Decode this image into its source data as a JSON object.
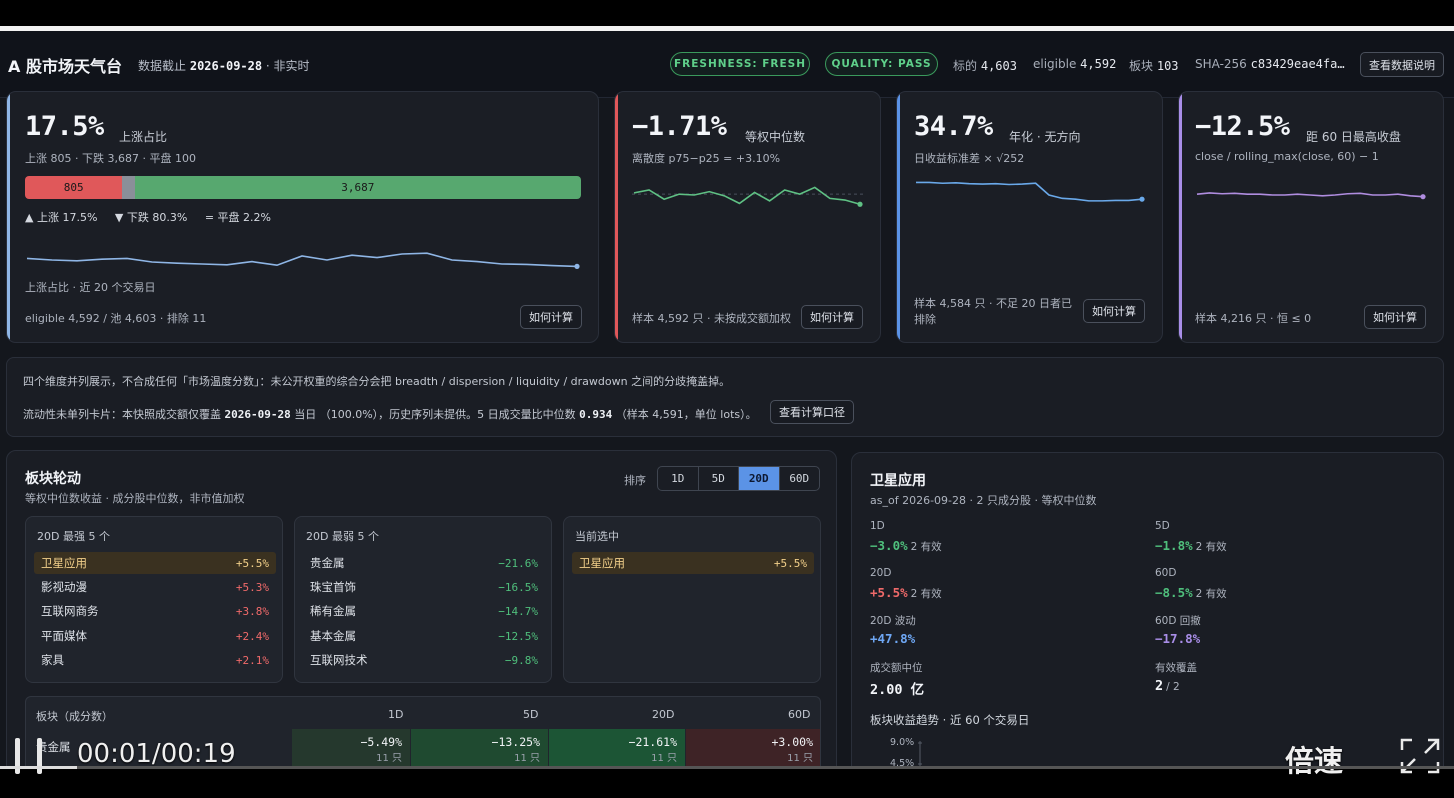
{
  "header": {
    "title": "A 股市场天气台",
    "date_label": "数据截止",
    "date": "2026-09-28",
    "date_suffix": "· 非实时",
    "freshness": "FRESHNESS: FRESH",
    "quality": "QUALITY: PASS",
    "stat1_label": "标的",
    "stat1_value": "4,603",
    "stat2_label": "eligible",
    "stat2_value": "4,592",
    "stat3_label": "板块",
    "stat3_value": "103",
    "hash_label": "SHA-256",
    "hash_value": "c83429eae4fa…",
    "data_button": "查看数据说明"
  },
  "cards": {
    "breadth": {
      "value": "17.5%",
      "unit": "上涨占比",
      "sub": "上涨 805 · 下跌 3,687 · 平盘 100",
      "up_count": 805,
      "down_count": 3687,
      "flat_count": 100,
      "up_label": "805",
      "down_label": "3,687",
      "legend_up": "▲ 上涨 17.5%",
      "legend_down": "▼ 下跌 80.3%",
      "legend_flat": "= 平盘 2.2%",
      "spark_label": "上涨占比 · 近 20 个交易日",
      "footer": "eligible 4,592 / 池 4,603 · 排除 11",
      "button": "如何计算",
      "spark": [
        0.44,
        0.4,
        0.38,
        0.42,
        0.44,
        0.35,
        0.32,
        0.3,
        0.28,
        0.36,
        0.27,
        0.5,
        0.4,
        0.52,
        0.46,
        0.55,
        0.57,
        0.4,
        0.36,
        0.3,
        0.29,
        0.26,
        0.24
      ]
    },
    "dispersion": {
      "value": "−1.71%",
      "unit": "等权中位数",
      "sub": "离散度 p75−p25 = +3.10%",
      "footer": "样本 4,592 只 · 未按成交额加权",
      "button": "如何计算",
      "spark": [
        0.55,
        0.62,
        0.4,
        0.52,
        0.5,
        0.58,
        0.48,
        0.3,
        0.56,
        0.36,
        0.62,
        0.52,
        0.68,
        0.42,
        0.38,
        0.28
      ]
    },
    "volatility": {
      "value": "34.7%",
      "unit": "年化 · 无方向",
      "sub": "日收益标准差 × √252",
      "footer_line1": "样本 4,584 只 · 不足 20 日者已",
      "footer_line2": "排除",
      "button": "如何计算",
      "spark": [
        0.8,
        0.8,
        0.78,
        0.79,
        0.77,
        0.76,
        0.77,
        0.75,
        0.76,
        0.78,
        0.5,
        0.42,
        0.4,
        0.36,
        0.36,
        0.37,
        0.37,
        0.4
      ]
    },
    "drawdown": {
      "value": "−12.5%",
      "unit": "距 60 日最高收盘",
      "sub": "close / rolling_max(close, 60) − 1",
      "footer": "样本 4,216 只 · 恒 ≤ 0",
      "button": "如何计算",
      "spark": [
        0.52,
        0.55,
        0.53,
        0.54,
        0.52,
        0.52,
        0.5,
        0.5,
        0.52,
        0.5,
        0.48,
        0.5,
        0.53,
        0.54,
        0.5,
        0.5,
        0.52,
        0.48,
        0.46
      ]
    }
  },
  "notes": {
    "line1": "四个维度并列展示，不合成任何「市场温度分数」：未公开权重的综合分会把 breadth / dispersion / liquidity / drawdown 之间的分歧掩盖掉。",
    "line2_a": "流动性未单列卡片：本快照成交额仅覆盖",
    "line2_date": "2026-09-28",
    "line2_b": "当日 （100.0%），历史序列未提供。5 日成交量比中位数",
    "line2_ratio": "0.934",
    "line2_c": "（样本 4,591，单位 lots）。",
    "button": "查看计算口径"
  },
  "sector": {
    "title": "板块轮动",
    "subtitle": "等权中位数收益 · 成分股中位数，非市值加权",
    "sort_label": "排序",
    "tabs": [
      "1D",
      "5D",
      "20D",
      "60D"
    ],
    "active_tab": "20D",
    "strong_title": "20D 最强 5 个",
    "strong": [
      {
        "name": "卫星应用",
        "value": "+5.5%"
      },
      {
        "name": "影视动漫",
        "value": "+5.3%"
      },
      {
        "name": "互联网商务",
        "value": "+3.8%"
      },
      {
        "name": "平面媒体",
        "value": "+2.4%"
      },
      {
        "name": "家具",
        "value": "+2.1%"
      }
    ],
    "weak_title": "20D 最弱 5 个",
    "weak": [
      {
        "name": "贵金属",
        "value": "−21.6%"
      },
      {
        "name": "珠宝首饰",
        "value": "−16.5%"
      },
      {
        "name": "稀有金属",
        "value": "−14.7%"
      },
      {
        "name": "基本金属",
        "value": "−12.5%"
      },
      {
        "name": "互联网技术",
        "value": "−9.8%"
      }
    ],
    "current_title": "当前选中",
    "current": {
      "name": "卫星应用",
      "value": "+5.5%"
    },
    "table": {
      "headers": [
        "板块（成分数）",
        "1D",
        "5D",
        "20D",
        "60D"
      ],
      "row": {
        "name": "贵金属",
        "c1": "−5.49%",
        "c2": "−13.25%",
        "c3": "−21.61%",
        "c4": "+3.00%",
        "n1": "11 只",
        "n2": "11 只",
        "n3": "11 只",
        "n4": "11 只"
      }
    }
  },
  "detail": {
    "title": "卫星应用",
    "subtitle": "as_of 2026-09-28 · 2 只成分股 · 等权中位数",
    "m1_label": "1D",
    "m1_value": "−3.0%",
    "m1_note": "2 有效",
    "m2_label": "5D",
    "m2_value": "−1.8%",
    "m2_note": "2 有效",
    "m3_label": "20D",
    "m3_value": "+5.5%",
    "m3_note": "2 有效",
    "m4_label": "60D",
    "m4_value": "−8.5%",
    "m4_note": "2 有效",
    "m5_label": "20D 波动",
    "m5_value": "+47.8%",
    "m6_label": "60D 回撤",
    "m6_value": "−17.8%",
    "m7_label": "成交额中位",
    "m7_value": "2.00 亿",
    "m8_label": "有效覆盖",
    "m8_value": "2",
    "m8_total": "/ 2",
    "trend_title": "板块收益趋势 · 近 60 个交易日",
    "trend_ticks": [
      "9.0%",
      "4.5%"
    ]
  },
  "player": {
    "time": "00:01/00:19",
    "speed": "倍速",
    "progress": 0.053
  },
  "colors": {
    "up_red": "#e0585a",
    "down_green": "#57a86f",
    "flat_gray": "#8a8f99",
    "accent_blue": "#5b93e6",
    "accent_purple": "#a98ee8",
    "spark_blue": "#8fb6e6",
    "spark_green": "#5fc184",
    "spark_line_blue": "#6aa9ea",
    "spark_purple": "#b08de0"
  }
}
